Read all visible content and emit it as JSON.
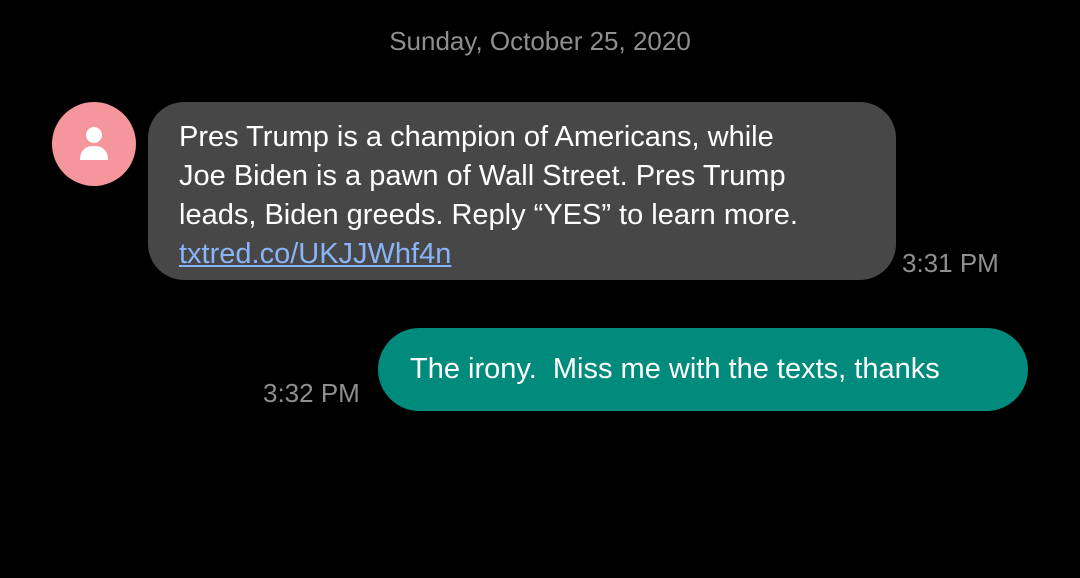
{
  "conversation": {
    "date_header": "Sunday, October 25, 2020",
    "messages": [
      {
        "direction": "incoming",
        "avatar_icon": "person-icon",
        "lines": [
          "Pres Trump is a champion of Americans, while",
          "Joe Biden is a pawn of Wall Street. Pres Trump",
          "leads, Biden greeds. Reply “YES” to learn more."
        ],
        "link": "txtred.co/UKJJWhf4n",
        "time": "3:31 PM"
      },
      {
        "direction": "outgoing",
        "text": "The irony.  Miss me with the texts, thanks",
        "time": "3:32 PM"
      }
    ]
  },
  "colors": {
    "background": "#000000",
    "incoming_bubble": "#474747",
    "outgoing_bubble": "#008b7d",
    "avatar": "#f5959c",
    "link": "#8ab4f8",
    "timestamp": "#8f8f8f"
  }
}
